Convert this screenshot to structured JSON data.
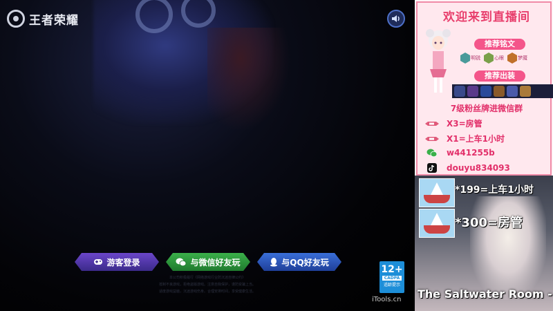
{
  "game": {
    "brand": "王者荣耀",
    "buttons": {
      "guest": "游客登录",
      "wechat": "与微信好友玩",
      "qq": "与QQ好友玩"
    },
    "footer_lines": [
      "本公司积极履行《网络游戏行业防沉迷自律公约》",
      "抵制不良游戏，拒绝盗版游戏。注意自我保护，谨防受骗上当。",
      "适度游戏益脑，沉迷游戏伤身。合理安排时间，享受健康生活。"
    ],
    "cadpa": {
      "age": "12+",
      "org": "CADPA",
      "note": "适龄提示"
    },
    "watermark": "iTools.cn",
    "colors": {
      "guest": "#5b3cb8",
      "wechat": "#2f9a3f",
      "qq": "#2d5cc4"
    }
  },
  "panel": {
    "title": "欢迎来到直播间",
    "rune_label": "推荐铭文",
    "runes": [
      {
        "name": "明锐",
        "color": "#4a9a9a"
      },
      {
        "name": "心眼",
        "color": "#7aa04a"
      },
      {
        "name": "梦魇",
        "color": "#c0702a"
      }
    ],
    "equip_label": "推荐出装",
    "equip_colors": [
      "#3a4a8a",
      "#5a3a8a",
      "#2a4a9a",
      "#8a5a2a",
      "#4a5aaa",
      "#aa7a3a"
    ],
    "info": {
      "title": "7级粉丝牌进微信群",
      "lines": [
        {
          "icon": "rocket-icon",
          "text": "X3=房管"
        },
        {
          "icon": "rocket-icon",
          "text": "X1=上车1小时"
        },
        {
          "icon": "wechat-icon",
          "text": "w441255b"
        },
        {
          "icon": "douyin-icon",
          "text": "douyu834093"
        }
      ]
    },
    "gifts": [
      {
        "text": "*199=上车1小时"
      },
      {
        "text": "*300=房管"
      }
    ],
    "ticker": "The Saltwater Room - Ow"
  }
}
